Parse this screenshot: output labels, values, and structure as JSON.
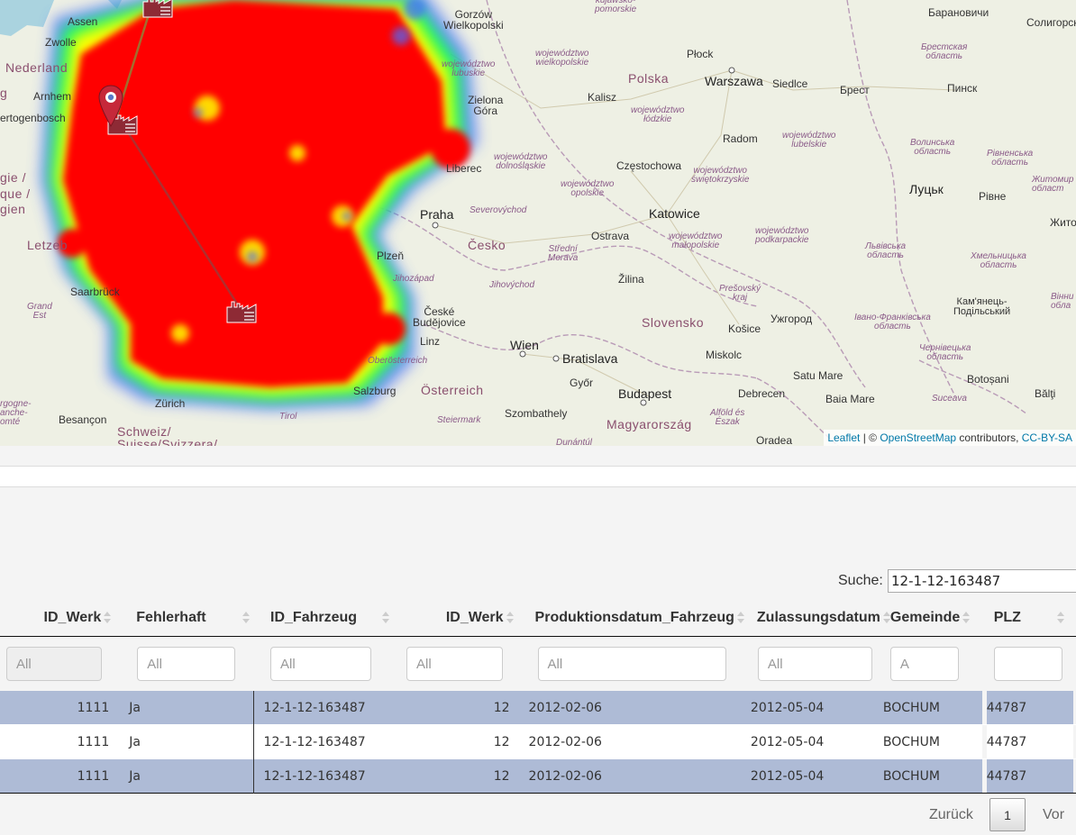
{
  "map": {
    "labels": {
      "assen": "Assen",
      "zwolle": "Zwolle",
      "nederland": "Nederland",
      "arnhem": "Arnhem",
      "hertogenbosch": "ertogenbosch",
      "g_left": "g",
      "belgie": "gie /",
      "que": "que /",
      "gien": "gien",
      "letzeb": "Letzeb",
      "saarbrucken": "Saarbrück",
      "grand_est": "Grand\nEst",
      "bourgogne": "rgogne-\nanche-\nomté",
      "besancon": "Besançon",
      "schweiz": "Schweiz/\nSuisse/Svizzera/",
      "zurich": "Zürich",
      "tirol": "Tirol",
      "gorzow": "Gorzów\nWielkopolski",
      "woj_kuj": "kujawsko-\npomorskie",
      "woj_wlkp": "województwo\nwielkopolskie",
      "woj_lub": "województwo\nlubuskie",
      "zielona_gora": "Zielona\nGóra",
      "kalisz": "Kalisz",
      "plock": "Płock",
      "polska": "Polska",
      "warszawa": "Warszawa",
      "siedlce": "Siedlce",
      "woj_lodz": "województwo\nłódzkie",
      "radom": "Radom",
      "woj_lubel": "województwo\nlubelskie",
      "czestochowa": "Częstochowa",
      "woj_dolno": "województwo\ndolnośląskie",
      "liberec": "Liberec",
      "woj_opol": "województwo\nopolskie",
      "woj_swiet": "województwo\nświętokrzyskie",
      "katowice": "Katowice",
      "praha": "Praha",
      "severovychod": "Severovýchod",
      "cesko": "Česko",
      "ostrava": "Ostrava",
      "woj_malop": "województwo\nmałopolskie",
      "woj_podk": "województwo\npodkarpackie",
      "plzen": "Plzeň",
      "stredni": "Střední\nMorava",
      "zilina": "Žilina",
      "jihozapad": "Jihozápad",
      "jihovychod": "Jihovýchod",
      "presov": "Prešovský\nkraj",
      "ceske_bud": "České\nBudějovice",
      "slovensko": "Slovensko",
      "uzhorod": "Ужгород",
      "kosice": "Košice",
      "linz": "Linz",
      "wien": "Wien",
      "bratislava": "Bratislava",
      "miskolc": "Miskolc",
      "oberosterreich": "Oberösterreich",
      "salzburg": "Salzburg",
      "osterreich": "Österreich",
      "gyor": "Győr",
      "budapest": "Budapest",
      "debrecen": "Debrecen",
      "satu_mare": "Satu Mare",
      "baia_mare": "Baia Mare",
      "szombathely": "Szombathely",
      "steiermark": "Steiermark",
      "magyarorszag": "Magyarország",
      "alfold": "Alföld és\nÉszak",
      "dunantul": "Dunántúl",
      "oradea": "Oradea",
      "suceava": "Suceava",
      "botosani": "Botoșani",
      "balti": "Bălţi",
      "baranovichi": "Барановичи",
      "soligorsk": "Солигорск",
      "brestskaya": "Брестская\nобласть",
      "brest": "Брест",
      "pinsk": "Пинск",
      "volynska": "Волинська\nобласть",
      "rivnenska": "Рівненська\nобласть",
      "zhytomyr": "Житомир\nобласт",
      "lutsk": "Луцьк",
      "rivne": "Рівне",
      "zhyt": "Жито",
      "lvivska": "Львівська\nобласть",
      "khmelnytska": "Хмельницька\nобласть",
      "kamianets": "Кам'янець-\nПодільський",
      "vinnyts": "Вінни\nобла",
      "ivano": "Івано-Франківська\nобласть",
      "chernivetska": "Чернівецька\nобласть"
    },
    "attribution": {
      "leaflet": "Leaflet",
      "sep": " | © ",
      "osm": "OpenStreetMap",
      "contrib": " contributors, ",
      "license": "CC-BY-SA"
    },
    "colors": {
      "heat_red": "#ff0000",
      "heat_yellow": "#ffff00",
      "heat_green": "#00ff66",
      "heat_blue": "#4a6cff",
      "line": "#b03a3a",
      "pin": "#c6283a"
    }
  },
  "table": {
    "search_label": "Suche:",
    "search_value": "12-1-12-163487",
    "columns": [
      "ID_Werk",
      "Fehlerhaft",
      "ID_Fahrzeug",
      "ID_Werk",
      "Produktionsdatum_Fahrzeug",
      "Zulassungsdatum",
      "Gemeinde",
      "PLZ"
    ],
    "filters": [
      "All",
      "All",
      "All",
      "All",
      "All",
      "All",
      "A",
      ""
    ],
    "rows": [
      [
        "1111",
        "Ja",
        "12-1-12-163487",
        "12",
        "2012-02-06",
        "2012-05-04",
        "BOCHUM",
        "44787"
      ],
      [
        "1111",
        "Ja",
        "12-1-12-163487",
        "12",
        "2012-02-06",
        "2012-05-04",
        "BOCHUM",
        "44787"
      ],
      [
        "1111",
        "Ja",
        "12-1-12-163487",
        "12",
        "2012-02-06",
        "2012-05-04",
        "BOCHUM",
        "44787"
      ]
    ]
  },
  "pagination": {
    "prev": "Zurück",
    "page": "1",
    "next": "Vor"
  }
}
